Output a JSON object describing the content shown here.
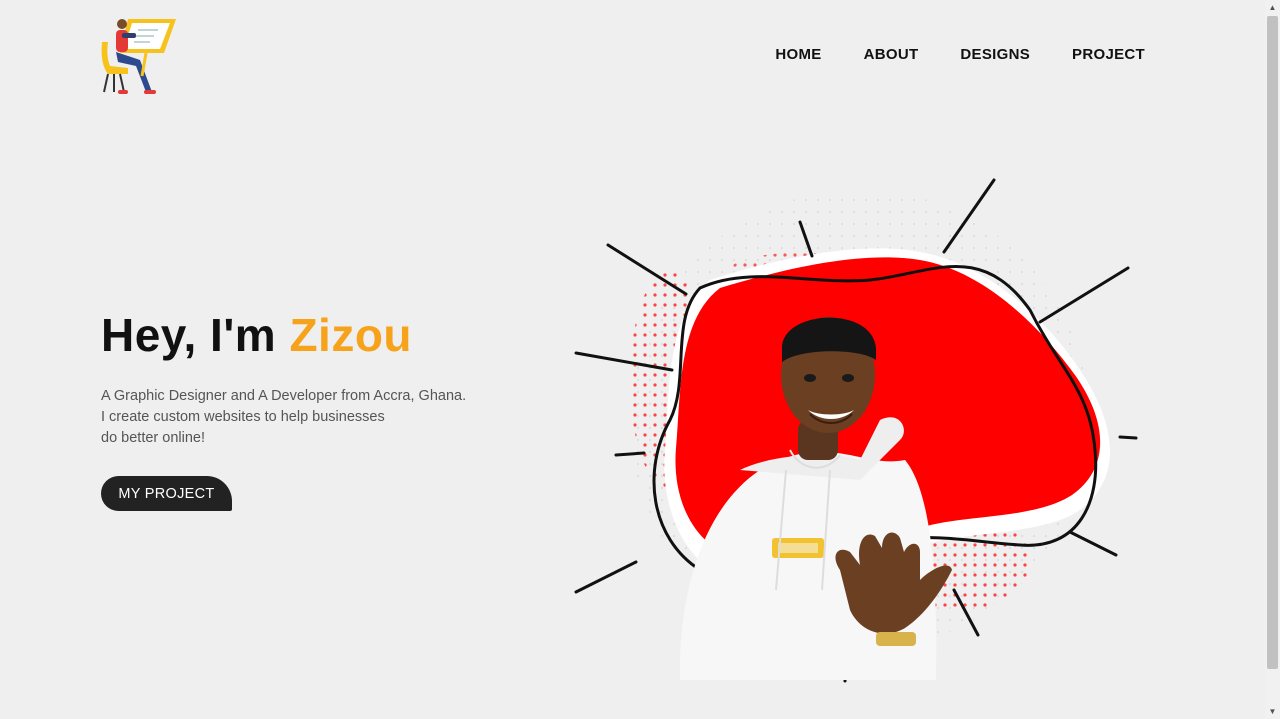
{
  "brand": {
    "logo_icon": "designer-at-drafting-table-icon"
  },
  "nav": {
    "items": [
      {
        "label": "HOME"
      },
      {
        "label": "ABOUT"
      },
      {
        "label": "DESIGNS"
      },
      {
        "label": "PROJECT"
      }
    ]
  },
  "hero": {
    "greeting": "Hey, I'm",
    "name": "Zizou",
    "description_lines": [
      "A Graphic Designer and A Developer from Accra, Ghana.",
      "I create custom websites to help businesses",
      "do better online!"
    ],
    "cta_label": "MY PROJECT"
  },
  "colors": {
    "accent": "#f7a21b",
    "blob": "#ff0000",
    "button": "#222222",
    "background": "#efefef"
  }
}
